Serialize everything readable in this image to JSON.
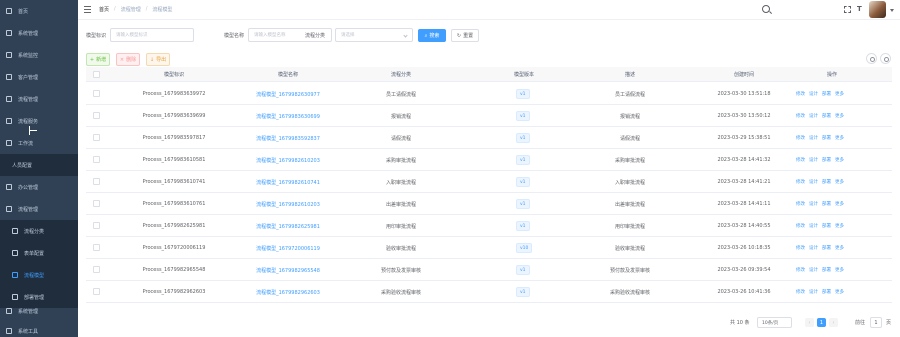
{
  "sidebar": {
    "items": [
      {
        "label": "首页"
      },
      {
        "label": "系统管理"
      },
      {
        "label": "系统监控"
      },
      {
        "label": "客户管理"
      },
      {
        "label": "流程管理"
      },
      {
        "label": "流程服务"
      },
      {
        "label": "工作流"
      },
      {
        "label": "人员配置"
      },
      {
        "label": "办公管理"
      },
      {
        "label": "流程管理"
      },
      {
        "label": "流程分类"
      },
      {
        "label": "表单配置"
      },
      {
        "label": "流程模型"
      },
      {
        "label": "部署管理"
      },
      {
        "label": "系统管理"
      },
      {
        "label": "系统工具"
      }
    ]
  },
  "navbar": {
    "breadcrumbs": [
      "首页",
      "流程管理",
      "流程模型"
    ]
  },
  "filters": {
    "model_key_label": "模型标识",
    "model_key_placeholder": "请输入模型标识",
    "model_name_label": "模型名称",
    "model_name_placeholder": "请输入模型名称",
    "category_label": "流程分类",
    "category_placeholder": "请选择",
    "search_label": "搜索",
    "reset_label": "重置"
  },
  "toolbar": {
    "add_label": "新增",
    "delete_label": "删除",
    "export_label": "导出"
  },
  "table": {
    "columns": [
      "模型标识",
      "模型名称",
      "流程分类",
      "模型版本",
      "描述",
      "创建时间",
      "操作"
    ],
    "rows": [
      {
        "key": "Process_1679983639972",
        "name": "流程模型_1679982630977",
        "category": "员工请假流程",
        "version": "v1",
        "desc": "员工请假流程",
        "time": "2023-03-30 13:51:18"
      },
      {
        "key": "Process_1679983639699",
        "name": "流程模型_1679983630699",
        "category": "报销流程",
        "version": "v1",
        "desc": "报销流程",
        "time": "2023-03-30 13:50:12"
      },
      {
        "key": "Process_1679983597817",
        "name": "流程模型_1679983592837",
        "category": "请假流程",
        "version": "v1",
        "desc": "请假流程",
        "time": "2023-03-29 15:38:51"
      },
      {
        "key": "Process_1679983610581",
        "name": "流程模型_1679982610203",
        "category": "采购审批流程",
        "version": "v1",
        "desc": "采购审批流程",
        "time": "2023-03-28 14:41:32"
      },
      {
        "key": "Process_1679983610741",
        "name": "流程模型_1679982610741",
        "category": "入职审批流程",
        "version": "v1",
        "desc": "入职审批流程",
        "time": "2023-03-28 14:41:21"
      },
      {
        "key": "Process_1679983610761",
        "name": "流程模型_1679982610203",
        "category": "出差审批流程",
        "version": "v1",
        "desc": "出差审批流程",
        "time": "2023-03-28 14:41:11"
      },
      {
        "key": "Process_1679982625981",
        "name": "流程模型_1679982625981",
        "category": "用印审批流程",
        "version": "v1",
        "desc": "用印审批流程",
        "time": "2023-03-28 14:40:55"
      },
      {
        "key": "Process_1679720006119",
        "name": "流程模型_1679720006119",
        "category": "验收审批流程",
        "version": "v10",
        "desc": "验收审批流程",
        "time": "2023-03-26 10:18:35"
      },
      {
        "key": "Process_1679982965548",
        "name": "流程模型_1679982965548",
        "category": "预付款及发票审核",
        "version": "v1",
        "desc": "预付款及发票审核",
        "time": "2023-03-26 09:39:54"
      },
      {
        "key": "Process_1679982962603",
        "name": "流程模型_1679982962603",
        "category": "采购验收流程审核",
        "version": "v1",
        "desc": "采购验收流程审核",
        "time": "2023-03-26 10:41:36"
      }
    ],
    "ops": [
      "修改",
      "设计",
      "部署",
      "更多"
    ]
  },
  "pagination": {
    "total_text": "共 10 条",
    "page_size": "10条/页",
    "current_page": "1",
    "goto_label": "前往",
    "goto_value": "1",
    "page_suffix": "页"
  },
  "colors": {
    "sidebar_bg": "#304156",
    "primary": "#409eff"
  }
}
